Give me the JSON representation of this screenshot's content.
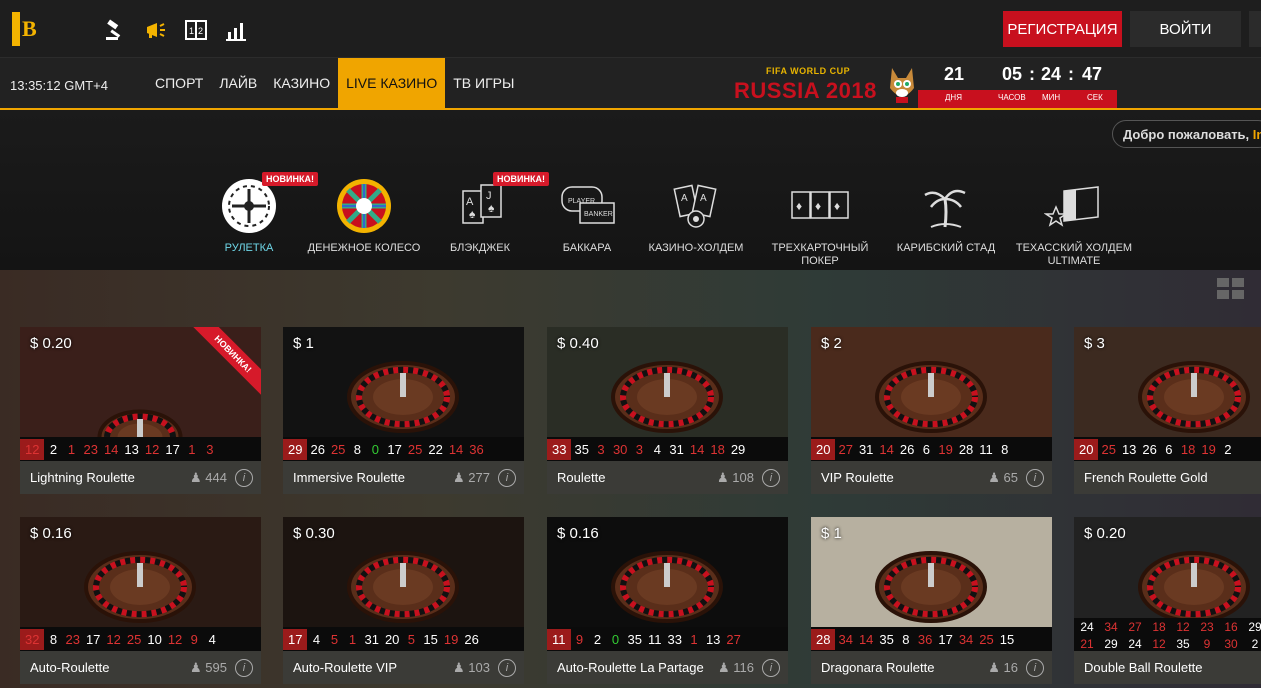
{
  "header": {
    "logo_text": "B",
    "icons": [
      "auction-icon",
      "megaphone-icon",
      "scoreboard-icon",
      "stats-icon"
    ],
    "register_label": "РЕГИСТРАЦИЯ",
    "login_label": "ВОЙТИ"
  },
  "navbar": {
    "clock": "13:35:12  GMT+4",
    "items": [
      "СПОРТ",
      "ЛАЙВ",
      "КАЗИНО",
      "LIVE КАЗИНО",
      "ТВ ИГРЫ"
    ],
    "active_index": 3
  },
  "worldcup": {
    "fifa": "FIFA WORLD CUP",
    "russia": "RUSSIA 2018",
    "days": "21",
    "hours": "05",
    "minutes": "24",
    "seconds": "47",
    "days_label": "ДНЯ",
    "hours_label": "ЧАСОВ",
    "minutes_label": "МИН",
    "seconds_label": "СЕК"
  },
  "welcome": {
    "text": "Добро пожаловать, ",
    "highlight": "Int"
  },
  "categories": [
    {
      "label": "РУЛЕТКА",
      "icon": "roulette-wheel-icon",
      "badge": "НОВИНКА!",
      "active": true
    },
    {
      "label": "ДЕНЕЖНОЕ КОЛЕСО",
      "icon": "money-wheel-icon",
      "badge": "",
      "active": false
    },
    {
      "label": "БЛЭКДЖЕК",
      "icon": "blackjack-cards-icon",
      "badge": "НОВИНКА!",
      "active": false
    },
    {
      "label": "БАККАРА",
      "icon": "baccarat-icon",
      "badge": "",
      "active": false
    },
    {
      "label": "КАЗИНО-ХОЛДЕМ",
      "icon": "holdem-cards-icon",
      "badge": "",
      "active": false
    },
    {
      "label": "ТРЕХКАРТОЧНЫЙ ПОКЕР",
      "icon": "three-card-poker-icon",
      "badge": "",
      "active": false
    },
    {
      "label": "КАРИБСКИЙ СТАД",
      "icon": "palm-tree-icon",
      "badge": "",
      "active": false
    },
    {
      "label": "ТЕХАССКИЙ ХОЛДЕМ ULTIMATE",
      "icon": "texas-flag-icon",
      "badge": "",
      "active": false
    }
  ],
  "games": [
    {
      "name": "Lightning Roulette",
      "price": "$ 0.20",
      "players": "444",
      "ribbon": "НОВИНКА!",
      "results": [
        [
          "12",
          "r"
        ],
        [
          "2",
          "b"
        ],
        [
          "1",
          "r"
        ],
        [
          "23",
          "r"
        ],
        [
          "14",
          "r"
        ],
        [
          "13",
          "b"
        ],
        [
          "12",
          "r"
        ],
        [
          "17",
          "b"
        ],
        [
          "1",
          "r"
        ],
        [
          "3",
          "r"
        ]
      ]
    },
    {
      "name": "Immersive Roulette",
      "price": "$ 1",
      "players": "277",
      "ribbon": "",
      "results": [
        [
          "29",
          "b"
        ],
        [
          "26",
          "b"
        ],
        [
          "25",
          "r"
        ],
        [
          "8",
          "b"
        ],
        [
          "0",
          "g"
        ],
        [
          "17",
          "b"
        ],
        [
          "25",
          "r"
        ],
        [
          "22",
          "b"
        ],
        [
          "14",
          "r"
        ],
        [
          "36",
          "r"
        ]
      ]
    },
    {
      "name": "Roulette",
      "price": "$ 0.40",
      "players": "108",
      "ribbon": "",
      "results": [
        [
          "33",
          "b"
        ],
        [
          "35",
          "b"
        ],
        [
          "3",
          "r"
        ],
        [
          "30",
          "r"
        ],
        [
          "3",
          "r"
        ],
        [
          "4",
          "b"
        ],
        [
          "31",
          "b"
        ],
        [
          "14",
          "r"
        ],
        [
          "18",
          "r"
        ],
        [
          "29",
          "b"
        ]
      ]
    },
    {
      "name": "VIP Roulette",
      "price": "$ 2",
      "players": "65",
      "ribbon": "",
      "results": [
        [
          "20",
          "b"
        ],
        [
          "27",
          "r"
        ],
        [
          "31",
          "b"
        ],
        [
          "14",
          "r"
        ],
        [
          "26",
          "b"
        ],
        [
          "6",
          "b"
        ],
        [
          "19",
          "r"
        ],
        [
          "28",
          "b"
        ],
        [
          "11",
          "b"
        ],
        [
          "8",
          "b"
        ]
      ]
    },
    {
      "name": "French Roulette Gold",
      "price": "$ 3",
      "players": "",
      "ribbon": "",
      "results": [
        [
          "20",
          "b"
        ],
        [
          "25",
          "r"
        ],
        [
          "13",
          "b"
        ],
        [
          "26",
          "b"
        ],
        [
          "6",
          "b"
        ],
        [
          "18",
          "r"
        ],
        [
          "19",
          "r"
        ],
        [
          "2",
          "b"
        ]
      ]
    },
    {
      "name": "Auto-Roulette",
      "price": "$ 0.16",
      "players": "595",
      "ribbon": "",
      "results": [
        [
          "32",
          "r"
        ],
        [
          "8",
          "b"
        ],
        [
          "23",
          "r"
        ],
        [
          "17",
          "b"
        ],
        [
          "12",
          "r"
        ],
        [
          "25",
          "r"
        ],
        [
          "10",
          "b"
        ],
        [
          "12",
          "r"
        ],
        [
          "9",
          "r"
        ],
        [
          "4",
          "b"
        ]
      ]
    },
    {
      "name": "Auto-Roulette VIP",
      "price": "$ 0.30",
      "players": "103",
      "ribbon": "",
      "results": [
        [
          "17",
          "b"
        ],
        [
          "4",
          "b"
        ],
        [
          "5",
          "r"
        ],
        [
          "1",
          "r"
        ],
        [
          "31",
          "b"
        ],
        [
          "20",
          "b"
        ],
        [
          "5",
          "r"
        ],
        [
          "15",
          "b"
        ],
        [
          "19",
          "r"
        ],
        [
          "26",
          "b"
        ]
      ]
    },
    {
      "name": "Auto-Roulette La Partage",
      "price": "$ 0.16",
      "players": "116",
      "ribbon": "",
      "results": [
        [
          "11",
          "b"
        ],
        [
          "9",
          "r"
        ],
        [
          "2",
          "b"
        ],
        [
          "0",
          "g"
        ],
        [
          "35",
          "b"
        ],
        [
          "11",
          "b"
        ],
        [
          "33",
          "b"
        ],
        [
          "1",
          "r"
        ],
        [
          "13",
          "b"
        ],
        [
          "27",
          "r"
        ]
      ]
    },
    {
      "name": "Dragonara Roulette",
      "price": "$ 1",
      "players": "16",
      "ribbon": "",
      "results": [
        [
          "28",
          "b"
        ],
        [
          "34",
          "r"
        ],
        [
          "14",
          "r"
        ],
        [
          "35",
          "b"
        ],
        [
          "8",
          "b"
        ],
        [
          "36",
          "r"
        ],
        [
          "17",
          "b"
        ],
        [
          "34",
          "r"
        ],
        [
          "25",
          "r"
        ],
        [
          "15",
          "b"
        ]
      ]
    },
    {
      "name": "Double Ball Roulette",
      "price": "$ 0.20",
      "players": "",
      "ribbon": "",
      "results": [
        [
          "24",
          "b"
        ],
        [
          "34",
          "r"
        ],
        [
          "27",
          "r"
        ],
        [
          "18",
          "r"
        ],
        [
          "12",
          "r"
        ],
        [
          "23",
          "r"
        ],
        [
          "16",
          "r"
        ],
        [
          "29",
          "b"
        ],
        [
          "21",
          "r"
        ],
        [
          "29",
          "b"
        ],
        [
          "24",
          "b"
        ],
        [
          "12",
          "r"
        ],
        [
          "35",
          "b"
        ],
        [
          "9",
          "r"
        ],
        [
          "30",
          "r"
        ],
        [
          "2",
          "b"
        ]
      ]
    }
  ]
}
